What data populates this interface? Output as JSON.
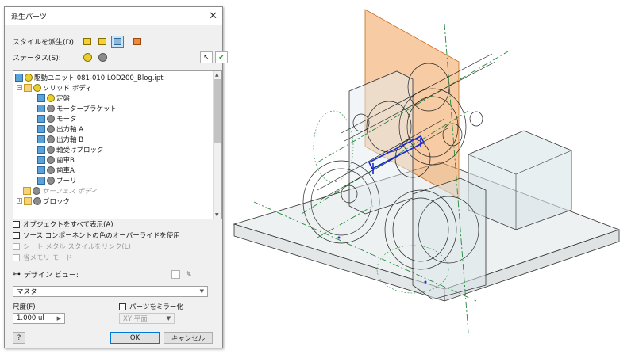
{
  "dialog": {
    "title": "派生パーツ",
    "style_label": "スタイルを派生(D):",
    "status_label": "ステータス(S):",
    "tree": [
      {
        "label": "駆動ユニット 081-010 LOD200_Blog.ipt",
        "icon": "part-icon",
        "indent": 0
      },
      {
        "label": "ソリッド ボディ",
        "icon": "folder-icon",
        "indent": 1
      },
      {
        "label": "定盤",
        "icon": "body-icon",
        "indent": 2
      },
      {
        "label": "モーターブラケット",
        "icon": "body-icon",
        "indent": 2
      },
      {
        "label": "モータ",
        "icon": "body-icon",
        "indent": 2
      },
      {
        "label": "出力軸 A",
        "icon": "body-icon",
        "indent": 2
      },
      {
        "label": "出力軸 B",
        "icon": "body-icon",
        "indent": 2
      },
      {
        "label": "軸受けブロック",
        "icon": "body-icon",
        "indent": 2
      },
      {
        "label": "歯車B",
        "icon": "body-icon",
        "indent": 2
      },
      {
        "label": "歯車A",
        "icon": "body-icon",
        "indent": 2
      },
      {
        "label": "プーリ",
        "icon": "body-icon",
        "indent": 2
      },
      {
        "label": "サーフェス ボディ",
        "icon": "folder-icon",
        "indent": 1
      },
      {
        "label": "ブロック",
        "icon": "folder-icon",
        "indent": 1
      }
    ],
    "show_all_label": "オブジェクトをすべて表示(A)",
    "override_label": "ソース コンポーネントの色のオーバーライドを使用",
    "sheetmetal_label": "シート メタル スタイルをリンク(L)",
    "reduced_memory_label": "省メモリ モード",
    "design_view_label": "デザイン ビュー:",
    "design_view_value": "マスター",
    "scale_label": "尺度(F)",
    "scale_value": "1.000 ul",
    "mirror_label": "パーツをミラー化",
    "mirror_plane": "XY 平面",
    "ok": "OK",
    "cancel": "キャンセル",
    "help": "?"
  },
  "colors": {
    "accent": "#0078d7",
    "plane": "#f0a35a",
    "selection": "#1a2bd4",
    "axis": "#1f8a3a"
  }
}
